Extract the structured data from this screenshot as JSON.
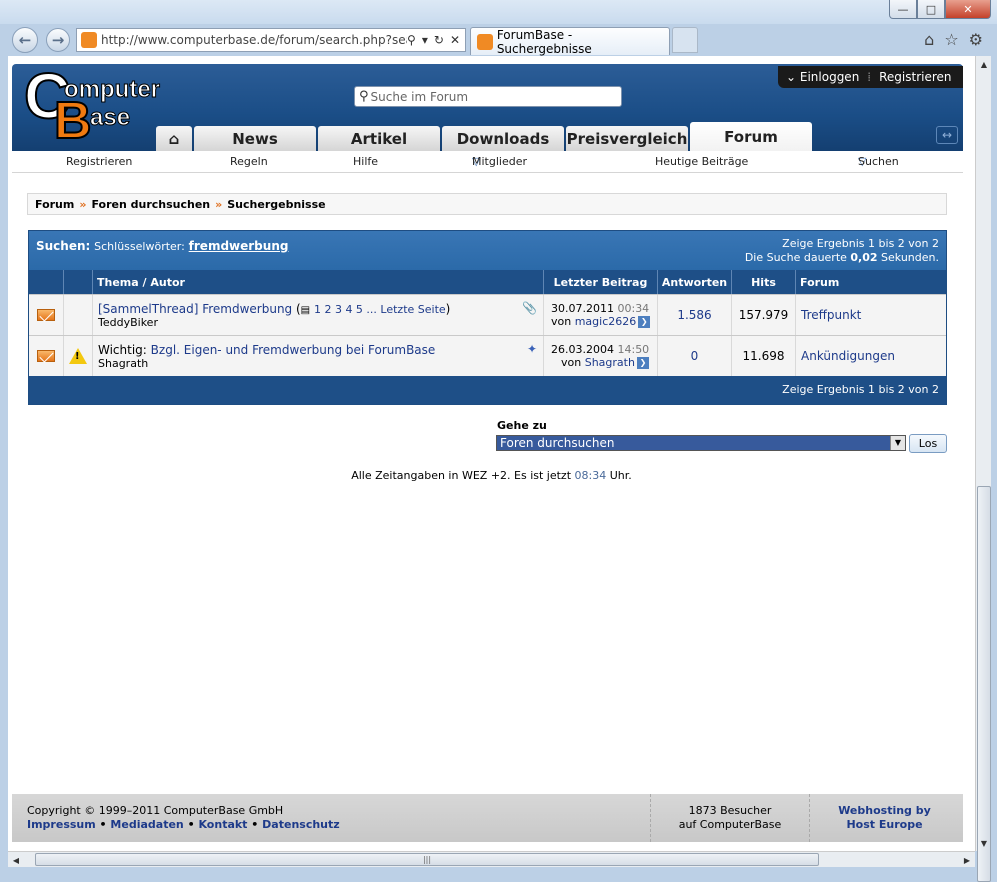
{
  "browser": {
    "address": "http://www.computerbase.de/forum/search.php?searc",
    "tab_title": "ForumBase - Suchergebnisse"
  },
  "header": {
    "logo_text_1": "omputer",
    "logo_text_2": "ase",
    "logo_c": "C",
    "logo_b": "B",
    "search_placeholder": "Suche im Forum",
    "login": "Einloggen",
    "register": "Registrieren",
    "tabs": [
      "News",
      "Artikel",
      "Downloads",
      "Preisvergleich",
      "Forum"
    ]
  },
  "subnav": {
    "items": [
      "Registrieren",
      "Regeln",
      "Hilfe",
      "Mitglieder",
      "Heutige Beiträge",
      "Suchen"
    ]
  },
  "breadcrumb": [
    "Forum",
    "Foren durchsuchen",
    "Suchergebnisse"
  ],
  "results": {
    "search_label": "Suchen:",
    "keywords_label": "Schlüsselwörter:",
    "keyword": "fremdwerbung",
    "result_info": "Zeige Ergebnis 1 bis 2 von 2",
    "duration_prefix": "Die Suche dauerte",
    "duration_value": "0,02",
    "duration_suffix": "Sekunden.",
    "columns": [
      "Thema / Autor",
      "Letzter Beitrag",
      "Antworten",
      "Hits",
      "Forum"
    ],
    "rows": [
      {
        "prefix": "",
        "title": "[SammelThread] Fremdwerbung",
        "pages": "1 2 3 4 5 ... Letzte Seite",
        "author": "TeddyBiker",
        "last_date": "30.07.2011",
        "last_time": "00:34",
        "last_by": "von",
        "last_user": "magic2626",
        "replies": "1.586",
        "hits": "157.979",
        "forum": "Treffpunkt"
      },
      {
        "prefix": "Wichtig:",
        "title": "Bzgl. Eigen- und Fremdwerbung bei ForumBase",
        "pages": "",
        "author": "Shagrath",
        "last_date": "26.03.2004",
        "last_time": "14:50",
        "last_by": "von",
        "last_user": "Shagrath",
        "replies": "0",
        "hits": "11.698",
        "forum": "Ankündigungen"
      }
    ],
    "footer_info": "Zeige Ergebnis 1 bis 2 von 2"
  },
  "goto": {
    "label": "Gehe zu",
    "selected": "Foren durchsuchen",
    "button": "Los"
  },
  "time_note": {
    "prefix": "Alle Zeitangaben in WEZ +2. Es ist jetzt",
    "time": "08:34",
    "suffix": "Uhr."
  },
  "footer": {
    "copyright": "Copyright © 1999–2011 ComputerBase GmbH",
    "links": [
      "Impressum",
      "Mediadaten",
      "Kontakt",
      "Datenschutz"
    ],
    "visitors_line1": "1873 Besucher",
    "visitors_line2": "auf ComputerBase",
    "host_line1": "Webhosting by",
    "host_line2": "Host Europe"
  },
  "colors": {
    "header_blue": "#1a4d86",
    "accent_orange": "#f07a10",
    "link_blue": "#1d3a8a"
  }
}
